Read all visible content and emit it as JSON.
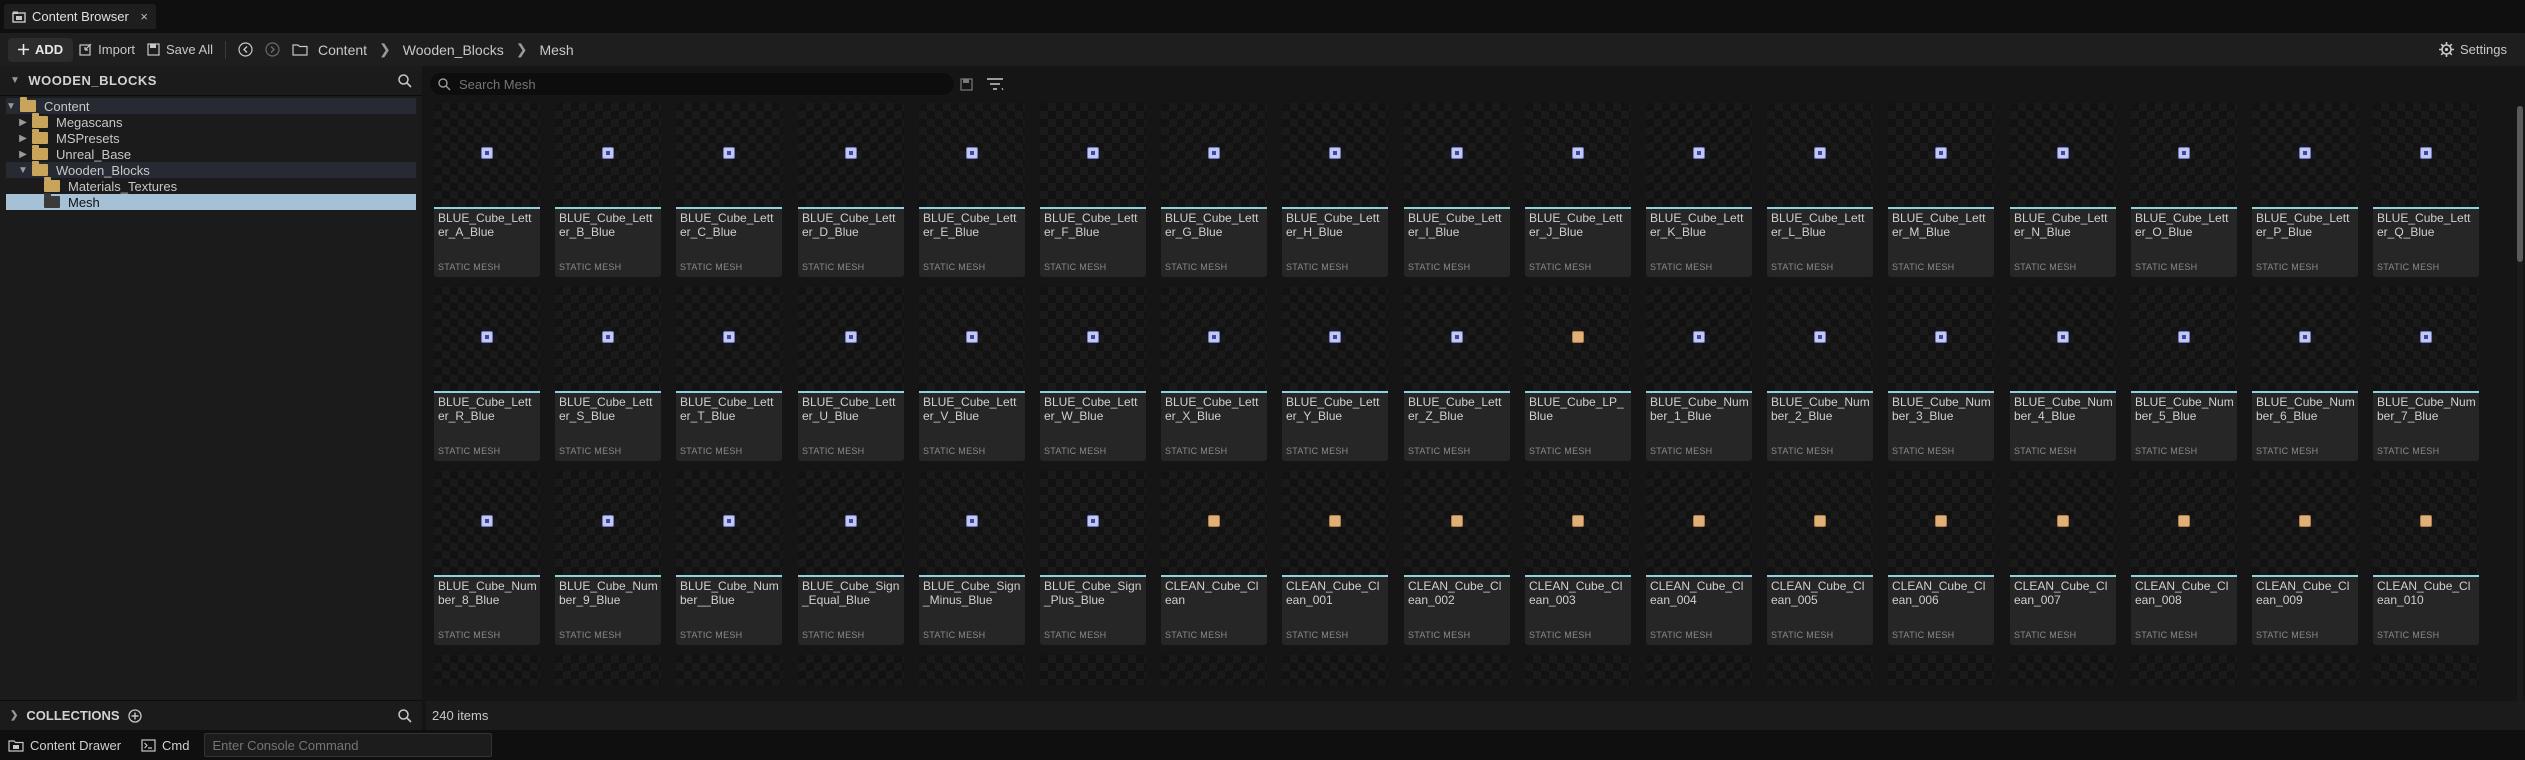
{
  "tab": {
    "title": "Content Browser",
    "close": "×"
  },
  "toolbar": {
    "add_label": "ADD",
    "import_label": "Import",
    "save_all_label": "Save All",
    "breadcrumbs": [
      "Content",
      "Wooden_Blocks",
      "Mesh"
    ],
    "settings_label": "Settings"
  },
  "sources": {
    "header": "WOODEN_BLOCKS",
    "tree": [
      {
        "label": "Content",
        "depth": 0,
        "expanded": true,
        "state": "hl"
      },
      {
        "label": "Megascans",
        "depth": 1,
        "expanded": false,
        "state": ""
      },
      {
        "label": "MSPresets",
        "depth": 1,
        "expanded": false,
        "state": ""
      },
      {
        "label": "Unreal_Base",
        "depth": 1,
        "expanded": false,
        "state": ""
      },
      {
        "label": "Wooden_Blocks",
        "depth": 1,
        "expanded": true,
        "state": "hl"
      },
      {
        "label": "Materials_Textures",
        "depth": 2,
        "expanded": null,
        "state": ""
      },
      {
        "label": "Mesh",
        "depth": 2,
        "expanded": null,
        "state": "selected"
      }
    ],
    "collections_label": "COLLECTIONS"
  },
  "search": {
    "placeholder": "Search Mesh"
  },
  "assets": [
    {
      "name": "BLUE_Cube_Letter_A_Blue",
      "type": "STATIC MESH",
      "kind": "blue"
    },
    {
      "name": "BLUE_Cube_Letter_B_Blue",
      "type": "STATIC MESH",
      "kind": "blue"
    },
    {
      "name": "BLUE_Cube_Letter_C_Blue",
      "type": "STATIC MESH",
      "kind": "blue"
    },
    {
      "name": "BLUE_Cube_Letter_D_Blue",
      "type": "STATIC MESH",
      "kind": "blue"
    },
    {
      "name": "BLUE_Cube_Letter_E_Blue",
      "type": "STATIC MESH",
      "kind": "blue"
    },
    {
      "name": "BLUE_Cube_Letter_F_Blue",
      "type": "STATIC MESH",
      "kind": "blue"
    },
    {
      "name": "BLUE_Cube_Letter_G_Blue",
      "type": "STATIC MESH",
      "kind": "blue"
    },
    {
      "name": "BLUE_Cube_Letter_H_Blue",
      "type": "STATIC MESH",
      "kind": "blue"
    },
    {
      "name": "BLUE_Cube_Letter_I_Blue",
      "type": "STATIC MESH",
      "kind": "blue"
    },
    {
      "name": "BLUE_Cube_Letter_J_Blue",
      "type": "STATIC MESH",
      "kind": "blue"
    },
    {
      "name": "BLUE_Cube_Letter_K_Blue",
      "type": "STATIC MESH",
      "kind": "blue"
    },
    {
      "name": "BLUE_Cube_Letter_L_Blue",
      "type": "STATIC MESH",
      "kind": "blue"
    },
    {
      "name": "BLUE_Cube_Letter_M_Blue",
      "type": "STATIC MESH",
      "kind": "blue"
    },
    {
      "name": "BLUE_Cube_Letter_N_Blue",
      "type": "STATIC MESH",
      "kind": "blue"
    },
    {
      "name": "BLUE_Cube_Letter_O_Blue",
      "type": "STATIC MESH",
      "kind": "blue"
    },
    {
      "name": "BLUE_Cube_Letter_P_Blue",
      "type": "STATIC MESH",
      "kind": "blue"
    },
    {
      "name": "BLUE_Cube_Letter_Q_Blue",
      "type": "STATIC MESH",
      "kind": "blue"
    },
    {
      "name": "BLUE_Cube_Letter_R_Blue",
      "type": "STATIC MESH",
      "kind": "blue"
    },
    {
      "name": "BLUE_Cube_Letter_S_Blue",
      "type": "STATIC MESH",
      "kind": "blue"
    },
    {
      "name": "BLUE_Cube_Letter_T_Blue",
      "type": "STATIC MESH",
      "kind": "blue"
    },
    {
      "name": "BLUE_Cube_Letter_U_Blue",
      "type": "STATIC MESH",
      "kind": "blue"
    },
    {
      "name": "BLUE_Cube_Letter_V_Blue",
      "type": "STATIC MESH",
      "kind": "blue"
    },
    {
      "name": "BLUE_Cube_Letter_W_Blue",
      "type": "STATIC MESH",
      "kind": "blue"
    },
    {
      "name": "BLUE_Cube_Letter_X_Blue",
      "type": "STATIC MESH",
      "kind": "blue"
    },
    {
      "name": "BLUE_Cube_Letter_Y_Blue",
      "type": "STATIC MESH",
      "kind": "blue"
    },
    {
      "name": "BLUE_Cube_Letter_Z_Blue",
      "type": "STATIC MESH",
      "kind": "blue"
    },
    {
      "name": "BLUE_Cube_LP_Blue",
      "type": "STATIC MESH",
      "kind": "clean"
    },
    {
      "name": "BLUE_Cube_Number_1_Blue",
      "type": "STATIC MESH",
      "kind": "blue"
    },
    {
      "name": "BLUE_Cube_Number_2_Blue",
      "type": "STATIC MESH",
      "kind": "blue"
    },
    {
      "name": "BLUE_Cube_Number_3_Blue",
      "type": "STATIC MESH",
      "kind": "blue"
    },
    {
      "name": "BLUE_Cube_Number_4_Blue",
      "type": "STATIC MESH",
      "kind": "blue"
    },
    {
      "name": "BLUE_Cube_Number_5_Blue",
      "type": "STATIC MESH",
      "kind": "blue"
    },
    {
      "name": "BLUE_Cube_Number_6_Blue",
      "type": "STATIC MESH",
      "kind": "blue"
    },
    {
      "name": "BLUE_Cube_Number_7_Blue",
      "type": "STATIC MESH",
      "kind": "blue"
    },
    {
      "name": "BLUE_Cube_Number_8_Blue",
      "type": "STATIC MESH",
      "kind": "blue"
    },
    {
      "name": "BLUE_Cube_Number_9_Blue",
      "type": "STATIC MESH",
      "kind": "blue"
    },
    {
      "name": "BLUE_Cube_Number__Blue",
      "type": "STATIC MESH",
      "kind": "blue"
    },
    {
      "name": "BLUE_Cube_Sign_Equal_Blue",
      "type": "STATIC MESH",
      "kind": "blue"
    },
    {
      "name": "BLUE_Cube_Sign_Minus_Blue",
      "type": "STATIC MESH",
      "kind": "blue"
    },
    {
      "name": "BLUE_Cube_Sign_Plus_Blue",
      "type": "STATIC MESH",
      "kind": "blue"
    },
    {
      "name": "CLEAN_Cube_Clean",
      "type": "STATIC MESH",
      "kind": "clean"
    },
    {
      "name": "CLEAN_Cube_Clean_001",
      "type": "STATIC MESH",
      "kind": "clean"
    },
    {
      "name": "CLEAN_Cube_Clean_002",
      "type": "STATIC MESH",
      "kind": "clean"
    },
    {
      "name": "CLEAN_Cube_Clean_003",
      "type": "STATIC MESH",
      "kind": "clean"
    },
    {
      "name": "CLEAN_Cube_Clean_004",
      "type": "STATIC MESH",
      "kind": "clean"
    },
    {
      "name": "CLEAN_Cube_Clean_005",
      "type": "STATIC MESH",
      "kind": "clean"
    },
    {
      "name": "CLEAN_Cube_Clean_006",
      "type": "STATIC MESH",
      "kind": "clean"
    },
    {
      "name": "CLEAN_Cube_Clean_007",
      "type": "STATIC MESH",
      "kind": "clean"
    },
    {
      "name": "CLEAN_Cube_Clean_008",
      "type": "STATIC MESH",
      "kind": "clean"
    },
    {
      "name": "CLEAN_Cube_Clean_009",
      "type": "STATIC MESH",
      "kind": "clean"
    },
    {
      "name": "CLEAN_Cube_Clean_010",
      "type": "STATIC MESH",
      "kind": "clean"
    }
  ],
  "display_names": [
    "BLUE_Cube_Letter\n_A_Blue",
    "BLUE_Cube_Letter\n_B_Blue",
    "BLUE_Cube_Letter\n_C_Blue",
    "BLUE_Cube_Letter\n_D_Blue",
    "BLUE_Cube_Letter\n_E_Blue",
    "BLUE_Cube_Letter\n_F_Blue",
    "BLUE_Cube_Letter\n_G_Blue",
    "BLUE_Cube_Letter\n_H_Blue",
    "BLUE_Cube_Letter\n_I_Blue",
    "BLUE_Cube_Letter\n_J_Blue",
    "BLUE_Cube_Letter\n_K_Blue",
    "BLUE_Cube_Letter\n_L_Blue",
    "BLUE_Cube_Letter\n_M_Blue",
    "BLUE_Cube_Letter\n_N_Blue",
    "BLUE_Cube_Letter\n_O_Blue",
    "BLUE_Cube_Letter\n_P_Blue",
    "BLUE_Cube_Letter\n_Q_Blue",
    "BLUE_Cube_Letter\n_R_Blue",
    "BLUE_Cube_Letter\n_S_Blue",
    "BLUE_Cube_Letter\n_T_Blue",
    "BLUE_Cube_Letter\n_U_Blue",
    "BLUE_Cube_Letter\n_V_Blue",
    "BLUE_Cube_Letter\n_W_Blue",
    "BLUE_Cube_Letter\n_X_Blue",
    "BLUE_Cube_Letter\n_Y_Blue",
    "BLUE_Cube_Letter\n_Z_Blue",
    "BLUE_Cube_LP_\nBlue",
    "BLUE_Cube_\nNumber_1_Blue",
    "BLUE_Cube_\nNumber_2_Blue",
    "BLUE_Cube_\nNumber_3_Blue",
    "BLUE_Cube_\nNumber_4_Blue",
    "BLUE_Cube_\nNumber_5_Blue",
    "BLUE_Cube_\nNumber_6_Blue",
    "BLUE_Cube_\nNumber_7_Blue",
    "BLUE_Cube_\nNumber_8_Blue",
    "BLUE_Cube_\nNumber_9_Blue",
    "BLUE_Cube_\nNumber__Blue",
    "BLUE_Cube_Sign_\nEqual_Blue",
    "BLUE_Cube_Sign_\nMinus_Blue",
    "BLUE_Cube_Sign_\nPlus_Blue",
    "CLEAN_Cube_\nClean",
    "CLEAN_Cube_\nClean_001",
    "CLEAN_Cube_\nClean_002",
    "CLEAN_Cube_\nClean_003",
    "CLEAN_Cube_\nClean_004",
    "CLEAN_Cube_\nClean_005",
    "CLEAN_Cube_\nClean_006",
    "CLEAN_Cube_\nClean_007",
    "CLEAN_Cube_\nClean_008",
    "CLEAN_Cube_\nClean_009",
    "CLEAN_Cube_\nClean_010"
  ],
  "status": {
    "item_count": "240 items"
  },
  "bottom": {
    "content_drawer_label": "Content Drawer",
    "cmd_label": "Cmd",
    "console_placeholder": "Enter Console Command"
  },
  "colors": {
    "accent": "#8fd3e2",
    "selected": "#a6c1d6",
    "folder": "#c9a45b"
  }
}
